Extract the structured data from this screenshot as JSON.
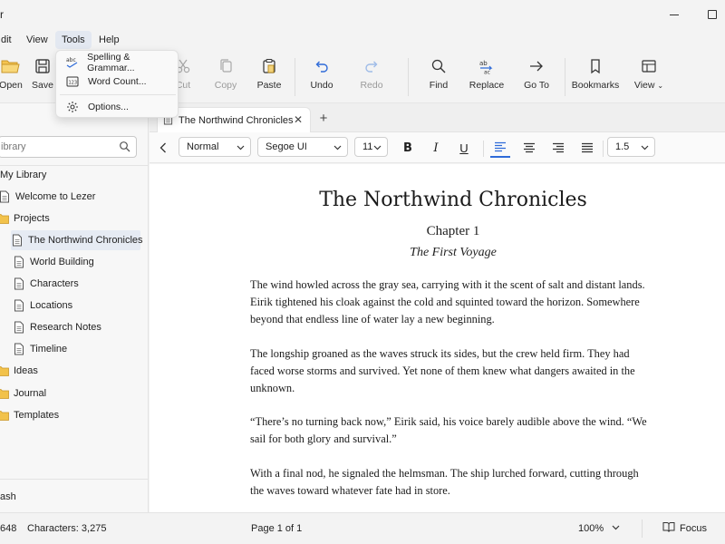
{
  "window": {
    "title": "r"
  },
  "menubar": {
    "items": [
      "dit",
      "View",
      "Tools",
      "Help"
    ],
    "active": "Tools"
  },
  "toolbar": {
    "open": "Open",
    "save": "Save",
    "cut": "Cut",
    "copy": "Copy",
    "paste": "Paste",
    "undo": "Undo",
    "redo": "Redo",
    "find": "Find",
    "replace": "Replace",
    "goto": "Go To",
    "bookmarks": "Bookmarks",
    "view": "View"
  },
  "tools_menu": {
    "items": [
      {
        "label": "Spelling & Grammar...",
        "icon": "spellcheck-icon"
      },
      {
        "label": "Word Count...",
        "icon": "word-count-icon"
      },
      {
        "label": "Options...",
        "icon": "gear-icon"
      }
    ]
  },
  "sidebar": {
    "search_placeholder": "ibrary",
    "root": "My Library",
    "items": [
      {
        "label": "Welcome to Lezer",
        "type": "doc"
      },
      {
        "label": "Projects",
        "type": "folder"
      },
      {
        "label": "The Northwind Chronicles",
        "type": "doc",
        "selected": true
      },
      {
        "label": "World Building",
        "type": "doc"
      },
      {
        "label": "Characters",
        "type": "doc"
      },
      {
        "label": "Locations",
        "type": "doc"
      },
      {
        "label": "Research Notes",
        "type": "doc"
      },
      {
        "label": "Timeline",
        "type": "doc"
      },
      {
        "label": "Ideas",
        "type": "folder"
      },
      {
        "label": "Journal",
        "type": "folder"
      },
      {
        "label": "Templates",
        "type": "folder"
      }
    ],
    "trash": "ash"
  },
  "tabs": {
    "items": [
      {
        "label": "The Northwind Chronicles"
      }
    ],
    "add_label": "+"
  },
  "format": {
    "style": "Normal",
    "font": "Segoe UI",
    "size": "11",
    "bold": "B",
    "italic": "I",
    "underline": "U",
    "line_spacing": "1.5"
  },
  "document": {
    "title": "The Northwind Chronicles",
    "chapter": "Chapter 1",
    "subtitle": "The First Voyage",
    "paragraphs": [
      "The wind howled across the gray sea, carrying with it the scent of salt and distant lands. Eirik tightened his cloak against the cold and squinted toward the horizon. Somewhere beyond that endless line of water lay a new beginning.",
      "The longship groaned as the waves struck its sides, but the crew held firm. They had faced worse storms and survived. Yet none of them knew what dangers awaited in the unknown.",
      "“There’s no turning back now,” Eirik said, his voice barely audible above the wind. “We sail for both glory and survival.”",
      "With a final nod, he signaled the helmsman. The ship lurched forward, cutting through the waves toward whatever fate had in store."
    ]
  },
  "status": {
    "words": "648",
    "characters": "Characters: 3,275",
    "page": "Page 1 of 1",
    "zoom": "100%",
    "focus": "Focus"
  },
  "colors": {
    "accent": "#2f6bd8",
    "folder": "#f2c24b",
    "selected_bg": "#e6ebf3"
  }
}
